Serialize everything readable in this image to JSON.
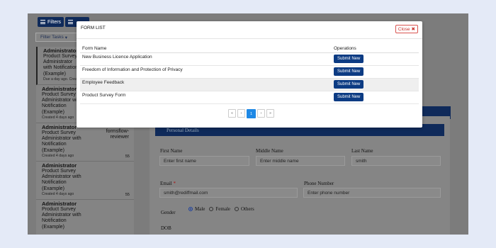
{
  "app": {
    "filters_label": "Filters",
    "filter_tasks_label": "Filter Tasks",
    "tasks": [
      {
        "who": "Administrator",
        "lines": [
          "Product Survey",
          "Administrator",
          "with Notification",
          "(Example)"
        ],
        "meta": "Due a day ago. Creat",
        "active": true
      },
      {
        "who": "Administrator",
        "lines": [
          "Product Survey",
          "Administrator with",
          "Notification",
          "(Example)"
        ],
        "meta": "Created 4 days ago",
        "active": false
      },
      {
        "who": "Administrator",
        "lines": [
          "Product Survey",
          "Administrator with",
          "Notification",
          "(Example)"
        ],
        "meta": "Created 4 days ago",
        "group": [
          "formsflow-",
          "reviewer"
        ],
        "count": "55",
        "active": false
      },
      {
        "who": "Administrator",
        "lines": [
          "Product Survey",
          "Administrator with",
          "Notification",
          "(Example)"
        ],
        "meta": "Created 4 days ago",
        "count": "55",
        "active": false
      },
      {
        "who": "Administrator",
        "lines": [
          "Product Survey",
          "Administrator with",
          "Notification",
          "(Example)"
        ],
        "meta": "",
        "active": false
      }
    ],
    "personal_details": "Personal Details",
    "fields": {
      "first_name_label": "First Name",
      "first_name_placeholder": "Enter first name",
      "middle_name_label": "Middle Name",
      "middle_name_placeholder": "Enter middle name",
      "last_name_label": "Last Name",
      "last_name_value": "smith",
      "email_label": "Email",
      "email_required": "*",
      "email_value": "smith@rediffmail.com",
      "phone_label": "Phone Number",
      "phone_placeholder": "Enter phone number",
      "gender_label": "Gender",
      "gender_options": [
        "Male",
        "Female",
        "Others"
      ],
      "gender_selected": "Male",
      "dob_label": "DOB"
    }
  },
  "modal": {
    "title": "FORM LIST",
    "close_label": "Close",
    "columns": [
      "Form Name",
      "Operations"
    ],
    "rows": [
      {
        "name": "New Business Licence Application",
        "action": "Submit New"
      },
      {
        "name": "Freedom of Information and Protection of Privacy",
        "action": "Submit New"
      },
      {
        "name": "Employee Feedback",
        "action": "Submit New"
      },
      {
        "name": "Product Survey Form",
        "action": "Submit New"
      }
    ],
    "pagination": {
      "first": "«",
      "prev": "‹",
      "current": "1",
      "next": "›",
      "last": "»"
    }
  }
}
